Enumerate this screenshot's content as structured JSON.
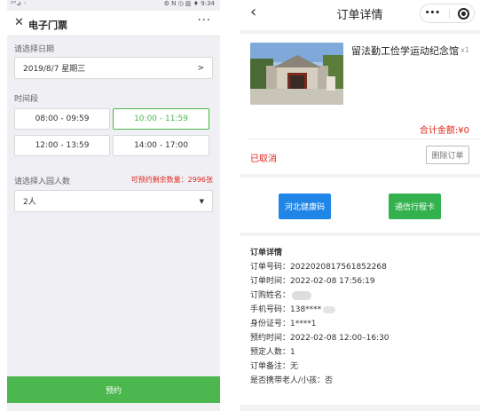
{
  "left": {
    "status": {
      "left_text": "²ᴴ⊿ ◦",
      "right_text": "⚙ N ◷ ▥ ♦ 9:34"
    },
    "title": "电子门票",
    "date_label": "请选择日期",
    "date_value": "2019/8/7 星期三",
    "date_chevron": ">",
    "time_label": "时间段",
    "slots": [
      "08:00 - 09:59",
      "10:00 - 11:59",
      "12:00 - 13:59",
      "14:00 - 17:00"
    ],
    "people_label": "请选择入园人数",
    "remaining": "可预约剩余数量：2996张",
    "people_value": "2人",
    "submit": "预约",
    "colors": {
      "selected": "#4cb74e",
      "remaining": "#e0281e"
    }
  },
  "right": {
    "title": "订单详情",
    "capsule_more": "•••",
    "product_name": "留法勤工俭学运动纪念馆",
    "qty": "x1",
    "total": "合计金额:¥0",
    "status": "已取消",
    "delete": "删除订单",
    "health_code": "河北健康码",
    "trip_card": "通信行程卡",
    "detail_heading": "订单详情",
    "details": [
      "订单号码：2022020817561852268",
      "订单时间：2022-02-08 17:56:19",
      "订购姓名：",
      "手机号码：138****",
      "身份证号：1****1",
      "预约时间：2022-02-08 12:00–16:30",
      "预定人数：1",
      "订单备注：无",
      "是否携带老人/小孩：否"
    ],
    "colors": {
      "blue": "#1f86e8",
      "green": "#33b14e",
      "red": "#e0281e"
    }
  }
}
